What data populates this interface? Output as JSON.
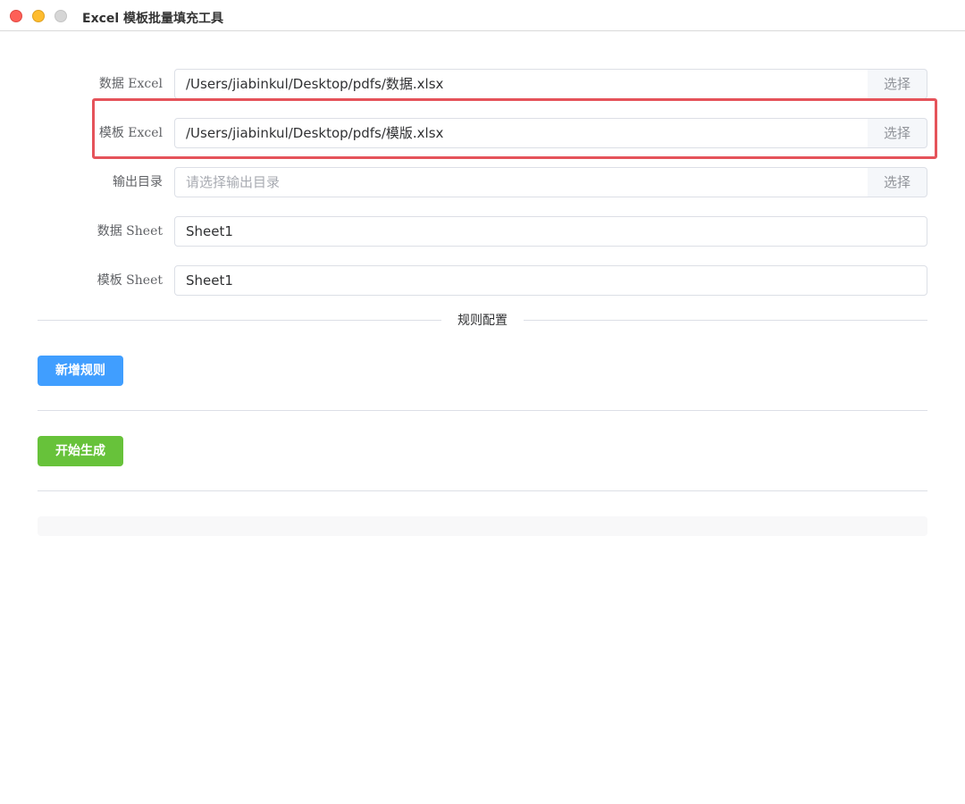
{
  "window": {
    "title": "Excel 模板批量填充工具"
  },
  "form": {
    "data_excel": {
      "label": "数据 Excel",
      "value": "/Users/jiabinkul/Desktop/pdfs/数据.xlsx",
      "button": "选择"
    },
    "template_excel": {
      "label": "模板 Excel",
      "value": "/Users/jiabinkul/Desktop/pdfs/模版.xlsx",
      "button": "选择"
    },
    "output_dir": {
      "label": "输出目录",
      "placeholder": "请选择输出目录",
      "value": "",
      "button": "选择"
    },
    "data_sheet": {
      "label": "数据 Sheet",
      "value": "Sheet1"
    },
    "template_sheet": {
      "label": "模板 Sheet",
      "value": "Sheet1"
    }
  },
  "rules": {
    "section_title": "规则配置",
    "add_rule_label": "新增规则"
  },
  "actions": {
    "start_label": "开始生成"
  },
  "colors": {
    "primary": "#409eff",
    "success": "#67c23a",
    "highlight": "#e5535a"
  }
}
